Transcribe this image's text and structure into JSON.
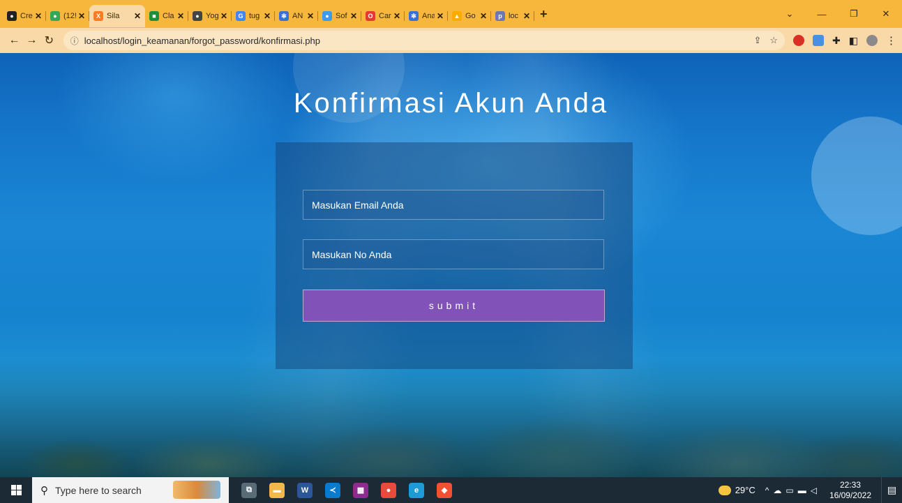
{
  "browser": {
    "tabs": [
      {
        "title": "Cre",
        "icon": "github-icon",
        "color": "#222222",
        "glyph": "●"
      },
      {
        "title": "(12!",
        "icon": "chat-badge-icon",
        "color": "#34a853",
        "glyph": "●"
      },
      {
        "title": "Sila",
        "icon": "xampp-icon",
        "color": "#fb7a24",
        "glyph": "X",
        "active": true
      },
      {
        "title": "Cla",
        "icon": "classroom-icon",
        "color": "#1e8e3e",
        "glyph": "■"
      },
      {
        "title": "Yog",
        "icon": "globe-icon",
        "color": "#444444",
        "glyph": "●"
      },
      {
        "title": "tug",
        "icon": "google-icon",
        "color": "#4285f4",
        "glyph": "G"
      },
      {
        "title": "AN",
        "icon": "network-icon",
        "color": "#3b6fd8",
        "glyph": "✻"
      },
      {
        "title": "Sof",
        "icon": "software-icon",
        "color": "#3d9be9",
        "glyph": "●"
      },
      {
        "title": "Car",
        "icon": "opera-icon",
        "color": "#e53935",
        "glyph": "O"
      },
      {
        "title": "Ana",
        "icon": "network-icon",
        "color": "#3b6fd8",
        "glyph": "✻"
      },
      {
        "title": "Go",
        "icon": "analytics-icon",
        "color": "#f9ab00",
        "glyph": "▲"
      },
      {
        "title": "loc",
        "icon": "phpmyadmin-icon",
        "color": "#6c78af",
        "glyph": "p"
      }
    ],
    "new_tab": "+",
    "url": "localhost/login_keamanan/forgot_password/konfirmasi.php"
  },
  "page": {
    "title": "Konfirmasi Akun Anda",
    "email_placeholder": "Masukan Email Anda",
    "phone_placeholder": "Masukan No Anda",
    "submit_label": "submit"
  },
  "taskbar": {
    "search_placeholder": "Type here to search",
    "apps": [
      {
        "name": "task-view",
        "color": "#5a6b78",
        "glyph": "⧉"
      },
      {
        "name": "file-explorer",
        "color": "#f2b84b",
        "glyph": "▬"
      },
      {
        "name": "word",
        "color": "#2b579a",
        "glyph": "W"
      },
      {
        "name": "vscode",
        "color": "#0a7acc",
        "glyph": "≺"
      },
      {
        "name": "winrar",
        "color": "#8e2b8e",
        "glyph": "▦"
      },
      {
        "name": "chrome",
        "color": "#e84a3c",
        "glyph": "●"
      },
      {
        "name": "edge",
        "color": "#1e9bd7",
        "glyph": "e"
      },
      {
        "name": "git",
        "color": "#f05133",
        "glyph": "◆"
      }
    ],
    "weather": "29°C",
    "time": "22:33",
    "date": "16/09/2022"
  }
}
